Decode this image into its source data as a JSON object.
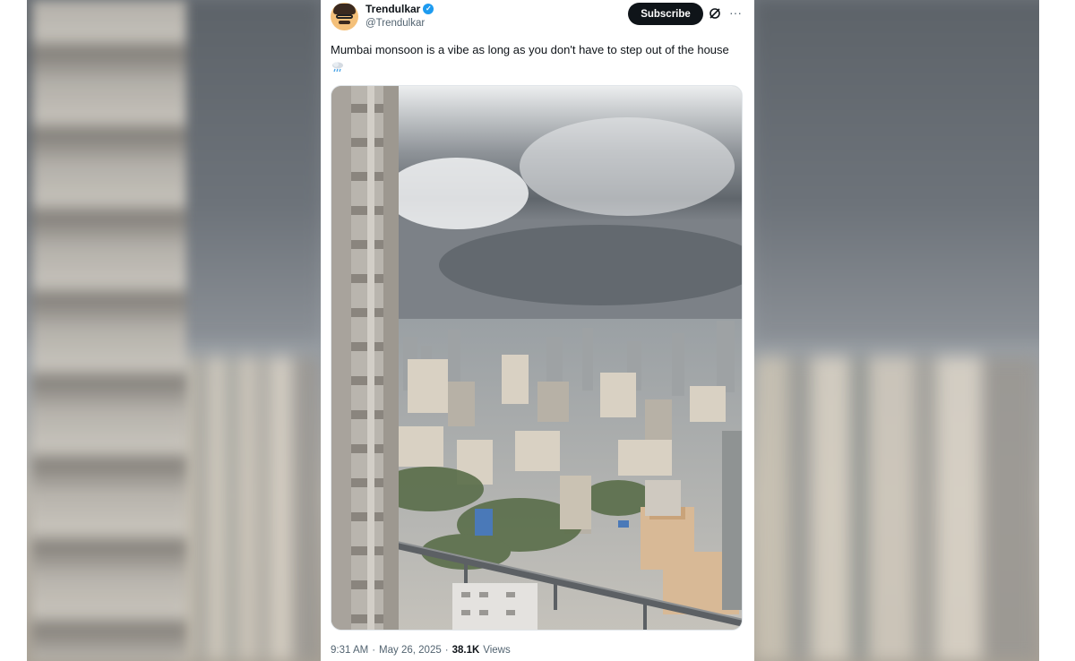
{
  "tweet": {
    "display_name": "Trendulkar",
    "handle": "@Trendulkar",
    "subscribe_label": "Subscribe",
    "text": "Mumbai monsoon is a vibe as long as you don't have to step out of the house",
    "time": "9:31 AM",
    "separator": "·",
    "date": "May 26, 2025",
    "views_count": "38.1K",
    "views_label": "Views"
  },
  "icons": {
    "verified": "verified-badge-icon",
    "grok": "grok-icon",
    "more": "more-options-icon",
    "emoji": "cloud-rain-emoji"
  },
  "colors": {
    "accent_blue": "#1d9bf0",
    "subscribe_bg": "#0f1419",
    "secondary_text": "#536471"
  }
}
